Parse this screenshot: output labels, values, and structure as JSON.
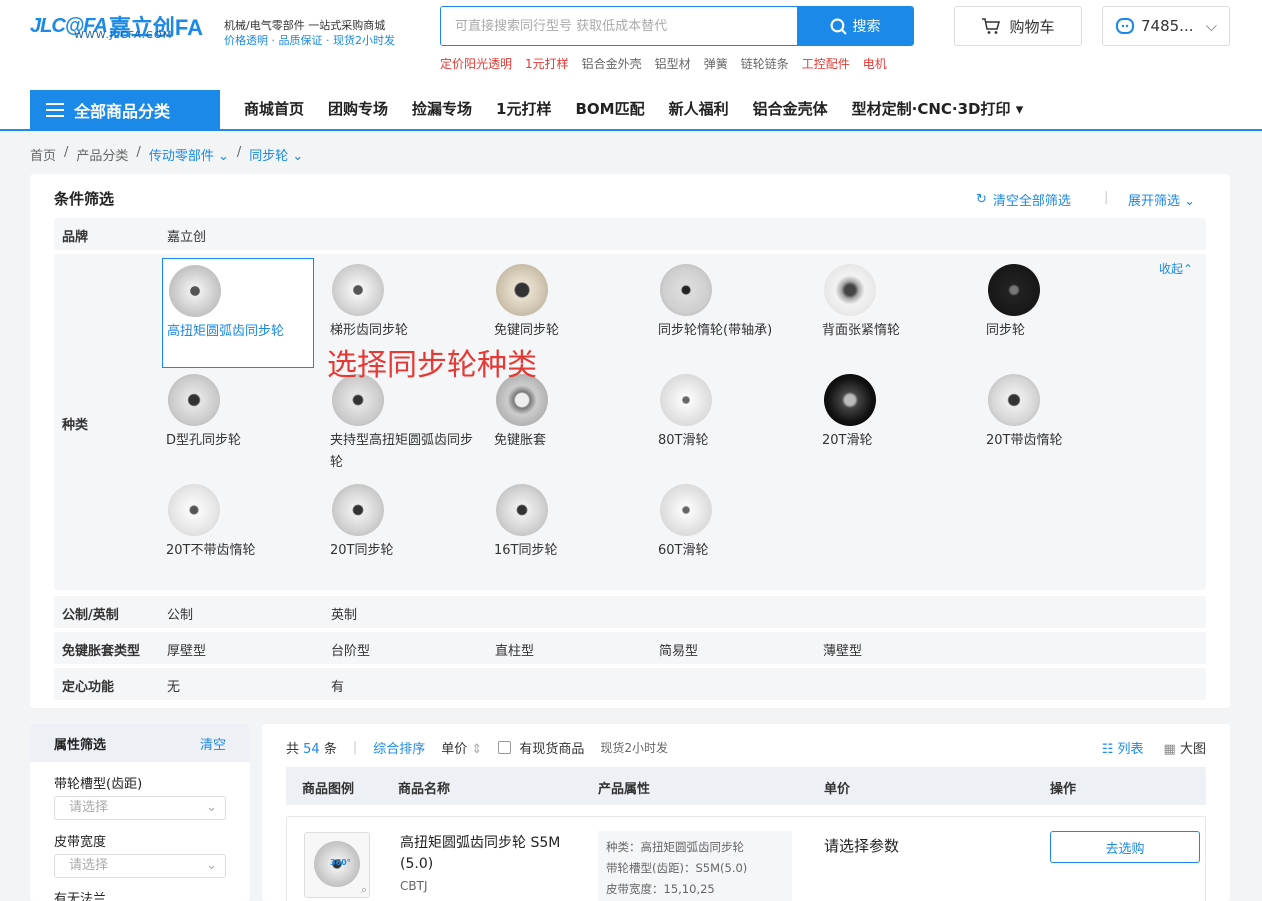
{
  "header": {
    "logo_mark": "JLC@FA",
    "logo_cn": "嘉立创FA",
    "logo_url": "WWW.JLCFA.COM",
    "tag_line1": "机械/电气零部件  一站式采购商城",
    "tag_line2": "价格透明 · 品质保证 · 现货2小时发",
    "search_placeholder": "可直接搜索同行型号 获取低成本替代",
    "search_button": "搜索",
    "hot": [
      "定价阳光透明",
      "1元打样",
      "铝合金外壳",
      "铝型材",
      "弹簧",
      "链轮链条",
      "工控配件",
      "电机"
    ],
    "cart": "购物车",
    "user": "7485...",
    "all_categories": "全部商品分类",
    "nav": [
      "商城首页",
      "团购专场",
      "捡漏专场",
      "1元打样",
      "BOM匹配",
      "新人福利",
      "铝合金壳体",
      "型材定制·CNC·3D打印"
    ]
  },
  "breadcrumb": [
    "首页",
    "产品分类",
    "传动零部件",
    "同步轮"
  ],
  "filter": {
    "title": "条件筛选",
    "clear": "清空全部筛选",
    "expand": "展开筛选",
    "collapse": "收起",
    "brand_label": "品牌",
    "brand_value": "嘉立创",
    "type_label": "种类",
    "types": [
      "高扭矩圆弧齿同步轮",
      "梯形齿同步轮",
      "免键同步轮",
      "同步轮惰轮(带轴承)",
      "背面张紧惰轮",
      "同步轮",
      "D型孔同步轮",
      "夹持型高扭矩圆弧齿同步轮",
      "免键胀套",
      "80T滑轮",
      "20T滑轮",
      "20T带齿惰轮",
      "20T不带齿惰轮",
      "20T同步轮",
      "16T同步轮",
      "60T滑轮"
    ],
    "annotation": "选择同步轮种类",
    "unit_label": "公制/英制",
    "unit_opts": [
      "公制",
      "英制"
    ],
    "sleeve_label": "免键胀套类型",
    "sleeve_opts": [
      "厚壁型",
      "台阶型",
      "直柱型",
      "简易型",
      "薄壁型"
    ],
    "center_label": "定心功能",
    "center_opts": [
      "无",
      "有"
    ]
  },
  "attr": {
    "title": "属性筛选",
    "clear": "清空",
    "f1": "带轮槽型(齿距)",
    "f2": "皮带宽度",
    "f3": "有无法兰",
    "placeholder": "请选择"
  },
  "list": {
    "count_prefix": "共",
    "count": "54",
    "count_suffix": "条",
    "sort": "综合排序",
    "price": "单价",
    "stock": "有现货商品",
    "stock_note": "现货2小时发",
    "view_list": "列表",
    "view_big": "大图",
    "cols": [
      "商品图例",
      "商品名称",
      "产品属性",
      "单价",
      "操作"
    ],
    "item": {
      "name": "高扭矩圆弧齿同步轮 S5M (5.0)",
      "brand": "CBTJ",
      "attr1": "种类：高扭矩圆弧齿同步轮",
      "attr2": "带轮槽型(齿距)：S5M(5.0)",
      "attr3": "皮带宽度：15,10,25",
      "price": "请选择参数",
      "button": "去选购",
      "badge": "360°"
    }
  },
  "colors": {
    "accent": "#1a89e8",
    "red": "#e53935"
  }
}
